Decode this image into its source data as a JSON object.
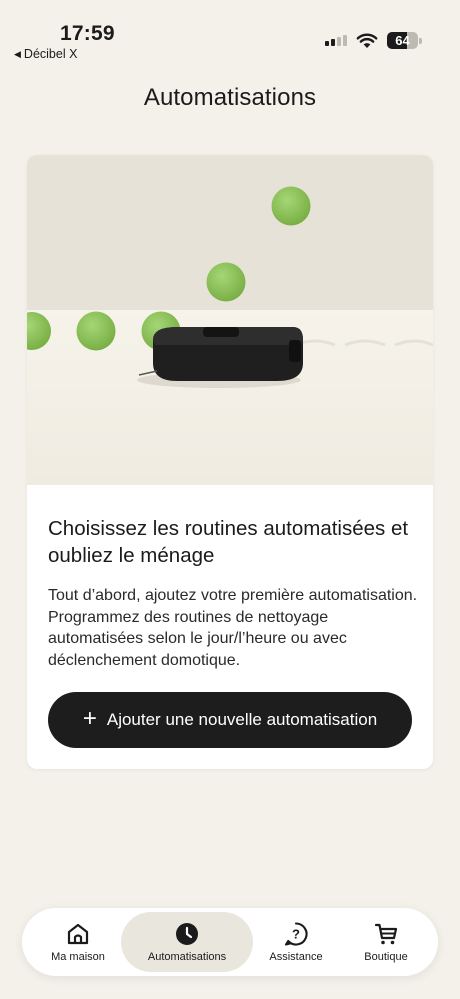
{
  "status": {
    "time": "17:59",
    "back_app": "Décibel X",
    "battery": "64"
  },
  "header": {
    "title": "Automatisations"
  },
  "card": {
    "heading": "Choisissez les routines automatisées et oubliez le ménage",
    "body": "Tout d’abord, ajoutez votre première automatisation. Programmez des routines de nettoyage automatisées selon le jour/l’heure ou avec déclenchement domotique.",
    "button_label": "Ajouter une nouvelle automatisation"
  },
  "nav": {
    "items": [
      {
        "label": "Ma maison",
        "icon": "home-icon"
      },
      {
        "label": "Automatisations",
        "icon": "clock-icon",
        "active": true
      },
      {
        "label": "Assistance",
        "icon": "help-icon"
      },
      {
        "label": "Boutique",
        "icon": "cart-icon"
      }
    ]
  },
  "colors": {
    "background": "#f3f1ea",
    "button": "#1d1d1d",
    "ball": "#8fc35a"
  }
}
